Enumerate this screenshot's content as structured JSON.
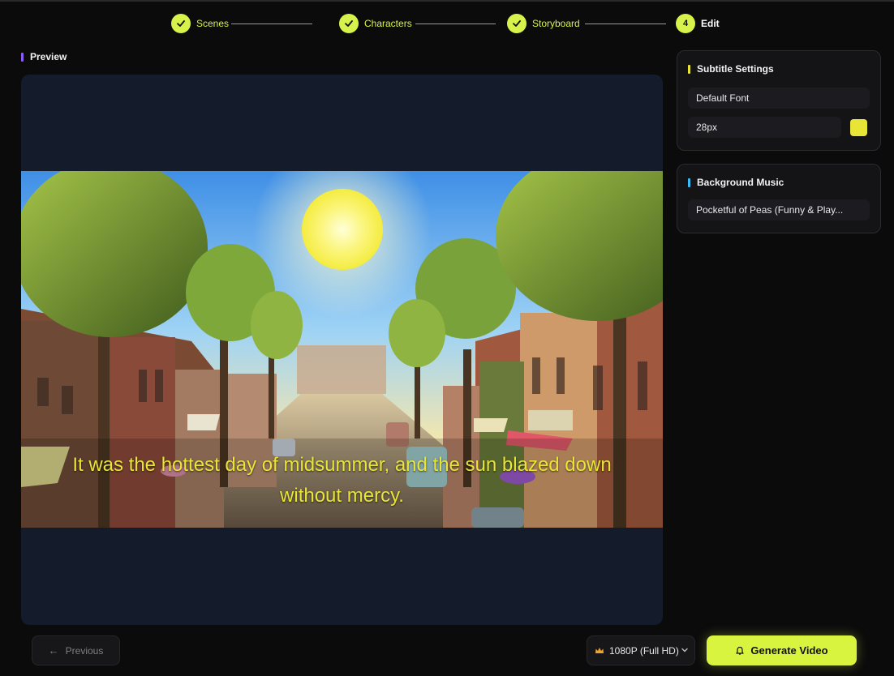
{
  "stepper": {
    "steps": [
      {
        "number": "1",
        "label": "Scenes",
        "state": "completed"
      },
      {
        "number": "2",
        "label": "Characters",
        "state": "completed"
      },
      {
        "number": "3",
        "label": "Storyboard",
        "state": "completed"
      },
      {
        "number": "4",
        "label": "Edit",
        "state": "active"
      }
    ],
    "icon": "check-icon"
  },
  "preview": {
    "title": "Preview",
    "subtitle_line1": "It was the hottest day of midsummer, and the sun blazed down",
    "subtitle_line2": "without mercy."
  },
  "subtitle_settings": {
    "title": "Subtitle Settings",
    "font": "Default Font",
    "size": "28px",
    "color": "#e8e536"
  },
  "background_music": {
    "title": "Background Music",
    "track": "Pocketful of Peas (Funny & Play..."
  },
  "footer": {
    "previous_label": "Previous",
    "resolution": "1080P (Full HD)",
    "generate_label": "Generate Video"
  },
  "colors": {
    "accent": "#d7f24a",
    "preview_bar": "#8b5cf6",
    "subtitle_bar": "#e8e536",
    "music_bar": "#38bdf8"
  }
}
